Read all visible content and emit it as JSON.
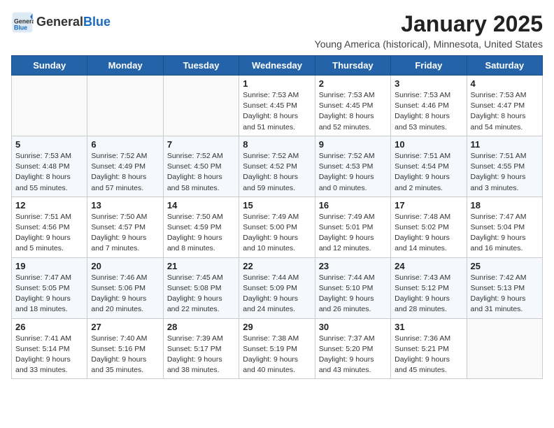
{
  "header": {
    "logo_general": "General",
    "logo_blue": "Blue",
    "title": "January 2025",
    "subtitle": "Young America (historical), Minnesota, United States"
  },
  "weekdays": [
    "Sunday",
    "Monday",
    "Tuesday",
    "Wednesday",
    "Thursday",
    "Friday",
    "Saturday"
  ],
  "weeks": [
    [
      {
        "day": "",
        "info": ""
      },
      {
        "day": "",
        "info": ""
      },
      {
        "day": "",
        "info": ""
      },
      {
        "day": "1",
        "info": "Sunrise: 7:53 AM\nSunset: 4:45 PM\nDaylight: 8 hours and 51 minutes."
      },
      {
        "day": "2",
        "info": "Sunrise: 7:53 AM\nSunset: 4:45 PM\nDaylight: 8 hours and 52 minutes."
      },
      {
        "day": "3",
        "info": "Sunrise: 7:53 AM\nSunset: 4:46 PM\nDaylight: 8 hours and 53 minutes."
      },
      {
        "day": "4",
        "info": "Sunrise: 7:53 AM\nSunset: 4:47 PM\nDaylight: 8 hours and 54 minutes."
      }
    ],
    [
      {
        "day": "5",
        "info": "Sunrise: 7:53 AM\nSunset: 4:48 PM\nDaylight: 8 hours and 55 minutes."
      },
      {
        "day": "6",
        "info": "Sunrise: 7:52 AM\nSunset: 4:49 PM\nDaylight: 8 hours and 57 minutes."
      },
      {
        "day": "7",
        "info": "Sunrise: 7:52 AM\nSunset: 4:50 PM\nDaylight: 8 hours and 58 minutes."
      },
      {
        "day": "8",
        "info": "Sunrise: 7:52 AM\nSunset: 4:52 PM\nDaylight: 8 hours and 59 minutes."
      },
      {
        "day": "9",
        "info": "Sunrise: 7:52 AM\nSunset: 4:53 PM\nDaylight: 9 hours and 0 minutes."
      },
      {
        "day": "10",
        "info": "Sunrise: 7:51 AM\nSunset: 4:54 PM\nDaylight: 9 hours and 2 minutes."
      },
      {
        "day": "11",
        "info": "Sunrise: 7:51 AM\nSunset: 4:55 PM\nDaylight: 9 hours and 3 minutes."
      }
    ],
    [
      {
        "day": "12",
        "info": "Sunrise: 7:51 AM\nSunset: 4:56 PM\nDaylight: 9 hours and 5 minutes."
      },
      {
        "day": "13",
        "info": "Sunrise: 7:50 AM\nSunset: 4:57 PM\nDaylight: 9 hours and 7 minutes."
      },
      {
        "day": "14",
        "info": "Sunrise: 7:50 AM\nSunset: 4:59 PM\nDaylight: 9 hours and 8 minutes."
      },
      {
        "day": "15",
        "info": "Sunrise: 7:49 AM\nSunset: 5:00 PM\nDaylight: 9 hours and 10 minutes."
      },
      {
        "day": "16",
        "info": "Sunrise: 7:49 AM\nSunset: 5:01 PM\nDaylight: 9 hours and 12 minutes."
      },
      {
        "day": "17",
        "info": "Sunrise: 7:48 AM\nSunset: 5:02 PM\nDaylight: 9 hours and 14 minutes."
      },
      {
        "day": "18",
        "info": "Sunrise: 7:47 AM\nSunset: 5:04 PM\nDaylight: 9 hours and 16 minutes."
      }
    ],
    [
      {
        "day": "19",
        "info": "Sunrise: 7:47 AM\nSunset: 5:05 PM\nDaylight: 9 hours and 18 minutes."
      },
      {
        "day": "20",
        "info": "Sunrise: 7:46 AM\nSunset: 5:06 PM\nDaylight: 9 hours and 20 minutes."
      },
      {
        "day": "21",
        "info": "Sunrise: 7:45 AM\nSunset: 5:08 PM\nDaylight: 9 hours and 22 minutes."
      },
      {
        "day": "22",
        "info": "Sunrise: 7:44 AM\nSunset: 5:09 PM\nDaylight: 9 hours and 24 minutes."
      },
      {
        "day": "23",
        "info": "Sunrise: 7:44 AM\nSunset: 5:10 PM\nDaylight: 9 hours and 26 minutes."
      },
      {
        "day": "24",
        "info": "Sunrise: 7:43 AM\nSunset: 5:12 PM\nDaylight: 9 hours and 28 minutes."
      },
      {
        "day": "25",
        "info": "Sunrise: 7:42 AM\nSunset: 5:13 PM\nDaylight: 9 hours and 31 minutes."
      }
    ],
    [
      {
        "day": "26",
        "info": "Sunrise: 7:41 AM\nSunset: 5:14 PM\nDaylight: 9 hours and 33 minutes."
      },
      {
        "day": "27",
        "info": "Sunrise: 7:40 AM\nSunset: 5:16 PM\nDaylight: 9 hours and 35 minutes."
      },
      {
        "day": "28",
        "info": "Sunrise: 7:39 AM\nSunset: 5:17 PM\nDaylight: 9 hours and 38 minutes."
      },
      {
        "day": "29",
        "info": "Sunrise: 7:38 AM\nSunset: 5:19 PM\nDaylight: 9 hours and 40 minutes."
      },
      {
        "day": "30",
        "info": "Sunrise: 7:37 AM\nSunset: 5:20 PM\nDaylight: 9 hours and 43 minutes."
      },
      {
        "day": "31",
        "info": "Sunrise: 7:36 AM\nSunset: 5:21 PM\nDaylight: 9 hours and 45 minutes."
      },
      {
        "day": "",
        "info": ""
      }
    ]
  ]
}
